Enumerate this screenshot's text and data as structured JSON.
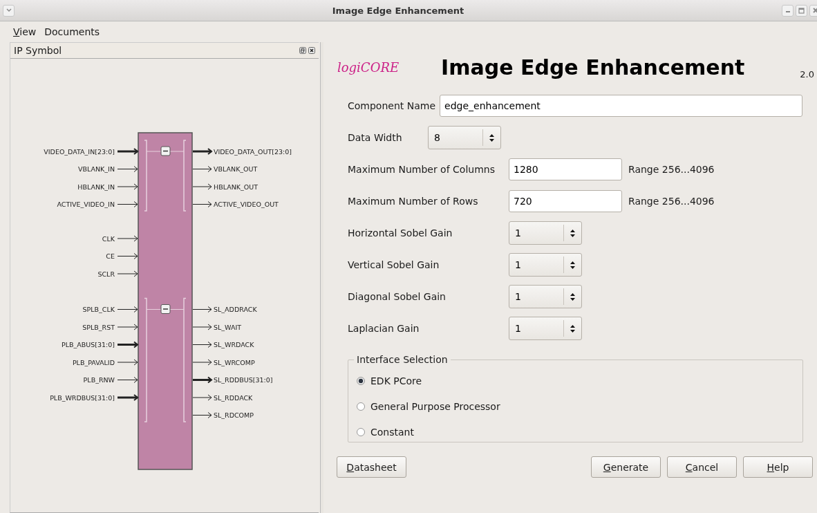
{
  "window": {
    "title": "Image Edge Enhancement"
  },
  "menu": [
    {
      "mnemonic": "V",
      "rest": "iew"
    },
    {
      "rest": "Documents"
    }
  ],
  "symbol_panel": {
    "title": "IP Symbol",
    "interfaces": [
      {
        "inputs": [
          {
            "name": "VIDEO_DATA_IN[23:0]",
            "bus": true
          },
          {
            "name": "VBLANK_IN",
            "bus": false
          },
          {
            "name": "HBLANK_IN",
            "bus": false
          },
          {
            "name": "ACTIVE_VIDEO_IN",
            "bus": false
          }
        ],
        "outputs": [
          {
            "name": "VIDEO_DATA_OUT[23:0]",
            "bus": true
          },
          {
            "name": "VBLANK_OUT",
            "bus": false
          },
          {
            "name": "HBLANK_OUT",
            "bus": false
          },
          {
            "name": "ACTIVE_VIDEO_OUT",
            "bus": false
          }
        ]
      },
      {
        "inputs": [
          {
            "name": "SPLB_CLK",
            "bus": false
          },
          {
            "name": "SPLB_RST",
            "bus": false
          },
          {
            "name": "PLB_ABUS[31:0]",
            "bus": true
          },
          {
            "name": "PLB_PAVALID",
            "bus": false
          },
          {
            "name": "PLB_RNW",
            "bus": false
          },
          {
            "name": "PLB_WRDBUS[31:0]",
            "bus": true
          }
        ],
        "outputs": [
          {
            "name": "SL_ADDRACK",
            "bus": false
          },
          {
            "name": "SL_WAIT",
            "bus": false
          },
          {
            "name": "SL_WRDACK",
            "bus": false
          },
          {
            "name": "SL_WRCOMP",
            "bus": false
          },
          {
            "name": "SL_RDDBUS[31:0]",
            "bus": true
          },
          {
            "name": "SL_RDDACK",
            "bus": false
          },
          {
            "name": "SL_RDCOMP",
            "bus": false
          }
        ]
      }
    ],
    "control_inputs": [
      {
        "name": "CLK",
        "bus": false
      },
      {
        "name": "CE",
        "bus": false
      },
      {
        "name": "SCLR",
        "bus": false
      }
    ]
  },
  "header": {
    "logo": "logiCORE",
    "title": "Image Edge Enhancement",
    "version": "2.0"
  },
  "fields": [
    {
      "kind": "text",
      "label": "Component Name",
      "value": "edge_enhancement"
    },
    {
      "kind": "spin",
      "label": "Data Width",
      "value": "8"
    },
    {
      "kind": "text",
      "label": "Maximum Number of Columns",
      "value": "1280",
      "hint": "Range 256...4096"
    },
    {
      "kind": "text",
      "label": "Maximum Number of Rows",
      "value": "720",
      "hint": "Range 256...4096"
    },
    {
      "kind": "spin",
      "label": "Horizontal Sobel Gain",
      "value": "1"
    },
    {
      "kind": "spin",
      "label": "Vertical Sobel Gain",
      "value": "1"
    },
    {
      "kind": "spin",
      "label": "Diagonal Sobel Gain",
      "value": "1"
    },
    {
      "kind": "spin",
      "label": "Laplacian Gain",
      "value": "1"
    }
  ],
  "interface_selection": {
    "title": "Interface Selection",
    "options": [
      {
        "label": "EDK PCore",
        "selected": true
      },
      {
        "label": "General Purpose Processor",
        "selected": false
      },
      {
        "label": "Constant",
        "selected": false
      }
    ]
  },
  "buttons": [
    {
      "mnemonic": "D",
      "rest": "atasheet"
    },
    {
      "mnemonic": "G",
      "rest": "enerate"
    },
    {
      "mnemonic": "C",
      "rest": "ancel"
    },
    {
      "mnemonic": "H",
      "rest": "elp"
    }
  ]
}
